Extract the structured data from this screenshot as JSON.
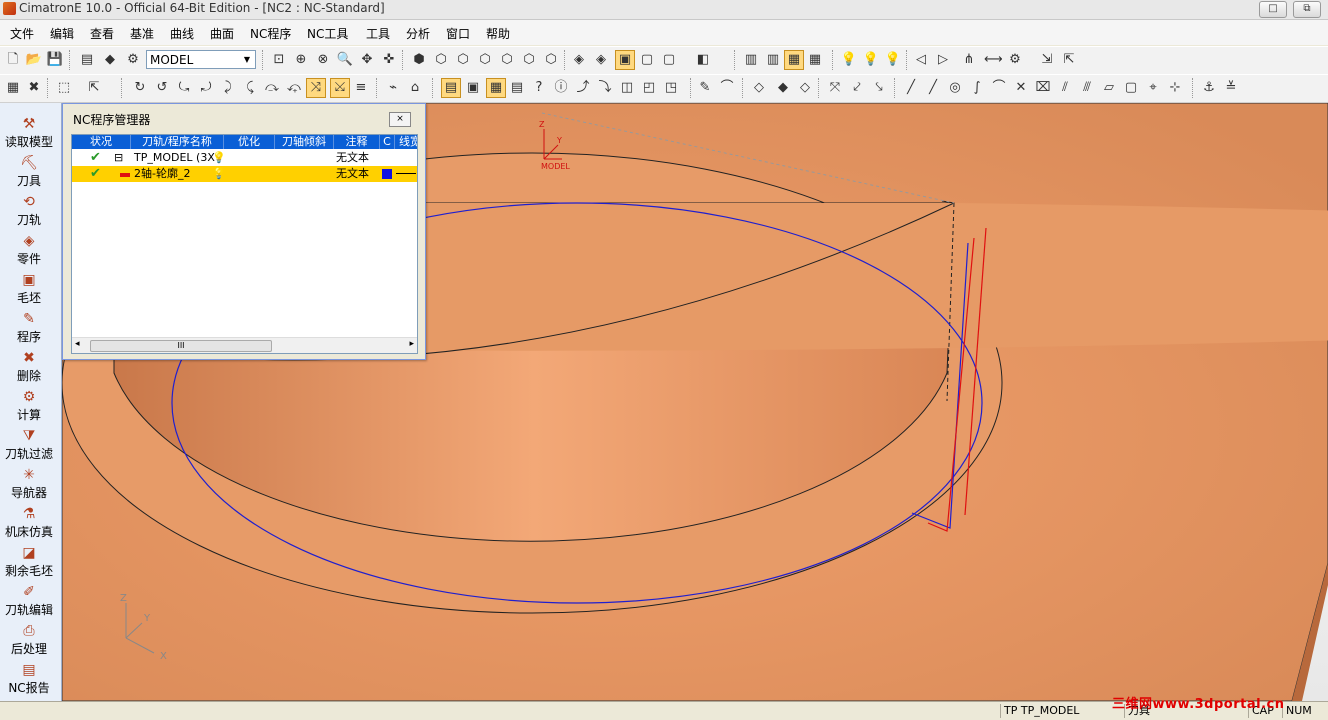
{
  "window": {
    "title": "CimatronE 10.0 - Official 64-Bit Edition - [NC2 : NC-Standard]",
    "restore_label": "□",
    "restore2_label": "⧉"
  },
  "menu": [
    "文件",
    "编辑",
    "查看",
    "基准",
    "曲线",
    "曲面",
    "NC程序",
    "NC工具",
    "工具",
    "分析",
    "窗口",
    "帮助"
  ],
  "toolbar": {
    "model_combo": "MODEL"
  },
  "left_tools": [
    "读取模型",
    "刀具",
    "刀轨",
    "零件",
    "毛坯",
    "程序",
    "删除",
    "计算",
    "刀轨过滤",
    "导航器",
    "机床仿真",
    "剩余毛坯",
    "刀轨编辑",
    "后处理",
    "NC报告"
  ],
  "nc_panel": {
    "title": "NC程序管理器",
    "close_label": "⨯",
    "columns": [
      "状况",
      "刀轨/程序名称",
      "优化",
      "刀轴倾斜",
      "注释",
      "C",
      "线宽"
    ],
    "rows": [
      {
        "expander": "⊟",
        "name": "TP_MODEL (3X",
        "comment": "无文本",
        "selected": false
      },
      {
        "expander": "",
        "name": "2轴-轮廓_2",
        "comment": "无文本",
        "selected": true
      }
    ],
    "scroll_thumb": "III"
  },
  "viewport": {
    "model_label": "MODEL",
    "axis_z": "Z",
    "axis_y": "Y",
    "axis_x": "X",
    "part_color": "#e0915f",
    "base_color": "#d98a58",
    "toolpath_blue": "#1f1fcf",
    "toolpath_red": "#e01010"
  },
  "status": {
    "tp": "TP",
    "model": "TP_MODEL",
    "tool": "刀具",
    "cap": "CAP",
    "num": "NUM"
  },
  "watermark": "三维网www.3dportal.cn"
}
